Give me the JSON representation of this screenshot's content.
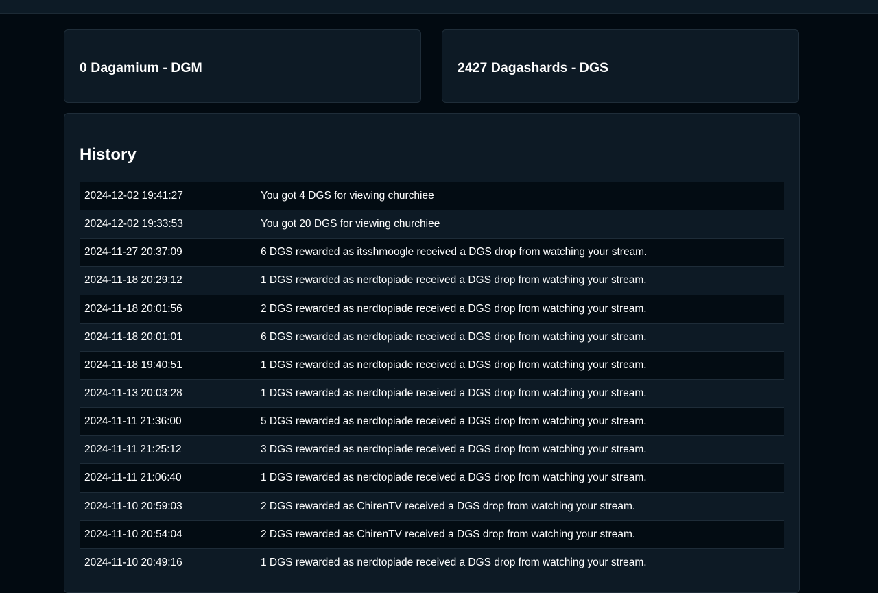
{
  "balances": {
    "dgm": "0 Dagamium - DGM",
    "dgs": "2427 Dagashards - DGS"
  },
  "history": {
    "title": "History",
    "rows": [
      {
        "date": "2024-12-02 19:41:27",
        "desc": "You got 4 DGS for viewing churchiee"
      },
      {
        "date": "2024-12-02 19:33:53",
        "desc": "You got 20 DGS for viewing churchiee"
      },
      {
        "date": "2024-11-27 20:37:09",
        "desc": "6 DGS rewarded as itsshmoogle received a DGS drop from watching your stream."
      },
      {
        "date": "2024-11-18 20:29:12",
        "desc": "1 DGS rewarded as nerdtopiade received a DGS drop from watching your stream."
      },
      {
        "date": "2024-11-18 20:01:56",
        "desc": "2 DGS rewarded as nerdtopiade received a DGS drop from watching your stream."
      },
      {
        "date": "2024-11-18 20:01:01",
        "desc": "6 DGS rewarded as nerdtopiade received a DGS drop from watching your stream."
      },
      {
        "date": "2024-11-18 19:40:51",
        "desc": "1 DGS rewarded as nerdtopiade received a DGS drop from watching your stream."
      },
      {
        "date": "2024-11-13 20:03:28",
        "desc": "1 DGS rewarded as nerdtopiade received a DGS drop from watching your stream."
      },
      {
        "date": "2024-11-11 21:36:00",
        "desc": "5 DGS rewarded as nerdtopiade received a DGS drop from watching your stream."
      },
      {
        "date": "2024-11-11 21:25:12",
        "desc": "3 DGS rewarded as nerdtopiade received a DGS drop from watching your stream."
      },
      {
        "date": "2024-11-11 21:06:40",
        "desc": "1 DGS rewarded as nerdtopiade received a DGS drop from watching your stream."
      },
      {
        "date": "2024-11-10 20:59:03",
        "desc": "2 DGS rewarded as ChirenTV received a DGS drop from watching your stream."
      },
      {
        "date": "2024-11-10 20:54:04",
        "desc": "2 DGS rewarded as ChirenTV received a DGS drop from watching your stream."
      },
      {
        "date": "2024-11-10 20:49:16",
        "desc": "1 DGS rewarded as nerdtopiade received a DGS drop from watching your stream."
      }
    ]
  }
}
